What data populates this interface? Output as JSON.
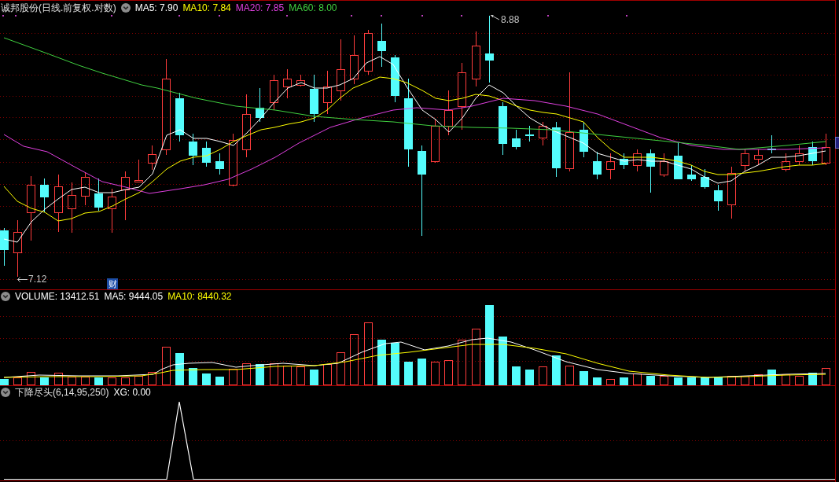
{
  "price_panel": {
    "title": "诚邦股份(日线.前复权.对数)",
    "indicators": [
      {
        "label": "MA5: 7.90",
        "color": "#ffffff"
      },
      {
        "label": "MA10: 7.84",
        "color": "#ffff00"
      },
      {
        "label": "MA20: 7.85",
        "color": "#e040e0"
      },
      {
        "label": "MA60: 8.00",
        "color": "#40d040"
      }
    ],
    "high_label": "8.88",
    "low_label": "7.12",
    "badge": "财"
  },
  "volume_panel": {
    "indicators": [
      {
        "label": "VOLUME: 13412.51",
        "color": "#ffffff"
      },
      {
        "label": "MA5: 9444.05",
        "color": "#ffffff"
      },
      {
        "label": "MA10: 8440.32",
        "color": "#ffff00"
      }
    ]
  },
  "indicator_panel": {
    "title": "下降尽头(6,14,95,250)",
    "indicators": [
      {
        "label": "XG: 0.00",
        "color": "#ffffff"
      }
    ]
  }
}
